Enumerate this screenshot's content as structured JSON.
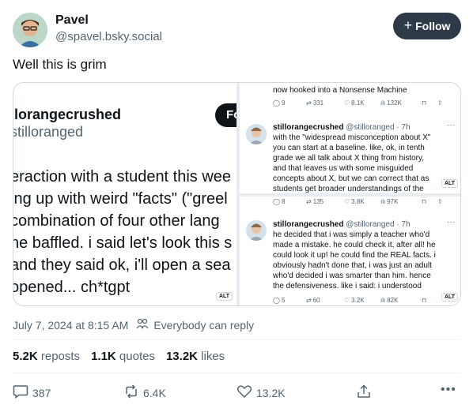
{
  "author": {
    "name": "Pavel",
    "handle": "@spavel.bsky.social",
    "follow_label": "Follow"
  },
  "post": {
    "text": "Well this is grim",
    "date": "July 7, 2024 at 8:15 AM",
    "reply_setting": "Everybody can reply"
  },
  "media": {
    "left": {
      "name": "llorangecrushed",
      "handle": "stilloranged",
      "follow_fragment": "Fo",
      "lines": [
        "eraction with a student this wee",
        "ing up with weird \"facts\" (\"greel",
        " combination of four other lang",
        "ne baffled. i said let's look this s",
        " and they said ok, i'll open a sea",
        "opened... ch*tgpt"
      ],
      "alt": "ALT"
    },
    "right_top": {
      "top_line": "now hooked into a Nonsense Machine",
      "stats_top": [
        "9",
        "331",
        "8.1K",
        "132K"
      ],
      "name": "stillorangecrushed",
      "handle_time": "@stilloranged · 7h",
      "lines": [
        "with the \"widespread misconception about X\"",
        "you can start at a baseline. like, ok, in tenth",
        "grade we all talk about X thing from history,",
        "and that leaves us with some misguided",
        "concepts about X, but we can correct that as",
        "students get broader understandings of the"
      ],
      "alt": "ALT"
    },
    "right_bottom": {
      "stats_top": [
        "8",
        "135",
        "3.8K",
        "97K"
      ],
      "name": "stillorangecrushed",
      "handle_time": "@stilloranged · 7h",
      "lines": [
        "he decided that i was simply a teacher who'd",
        "made a mistake. he could check it, after all! he",
        "could look it up! he could find the REAL facts. i",
        "obviously hadn't done that, i was just an adult",
        "who'd decided i was smarter than him. hence",
        "the defensiveness. like i said: i understood"
      ],
      "stats_bottom": [
        "5",
        "60",
        "3.2K",
        "82K"
      ],
      "alt": "ALT"
    }
  },
  "counts": {
    "reposts_value": "5.2K",
    "reposts_label": "reposts",
    "quotes_value": "1.1K",
    "quotes_label": "quotes",
    "likes_value": "13.2K",
    "likes_label": "likes"
  },
  "actions": {
    "replies": "387",
    "reposts": "6.4K",
    "likes": "13.2K"
  },
  "colors": {
    "follow_bg": "#2e3a47",
    "muted": "#536471",
    "border": "#cfd9de"
  }
}
